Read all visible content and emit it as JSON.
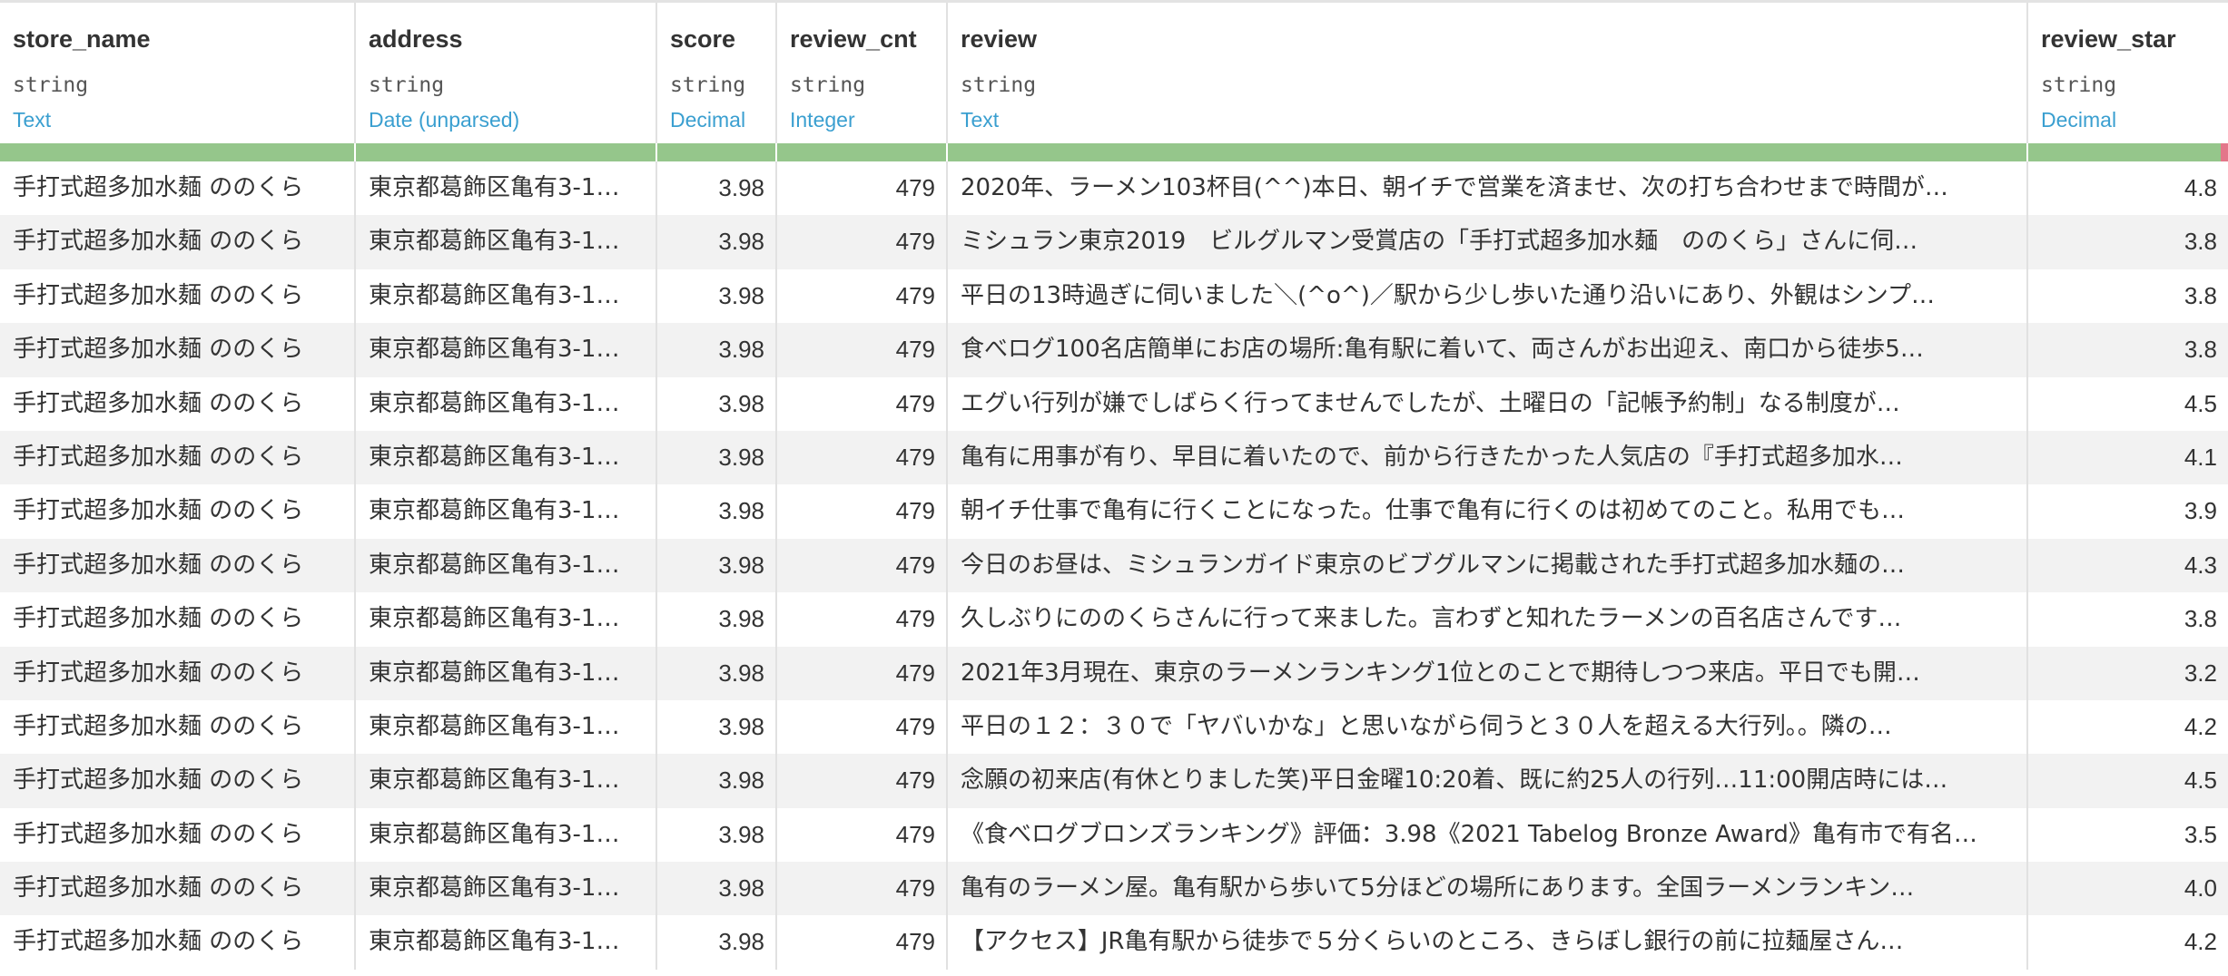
{
  "columns": [
    {
      "name": "store_name",
      "type": "string",
      "meaning": "Text"
    },
    {
      "name": "address",
      "type": "string",
      "meaning": "Date (unparsed)"
    },
    {
      "name": "score",
      "type": "string",
      "meaning": "Decimal"
    },
    {
      "name": "review_cnt",
      "type": "string",
      "meaning": "Integer"
    },
    {
      "name": "review",
      "type": "string",
      "meaning": "Text"
    },
    {
      "name": "review_star",
      "type": "string",
      "meaning": "Decimal"
    }
  ],
  "quality": {
    "valid_color": "#95c68b",
    "invalid_color": "#e3778a"
  },
  "rows": [
    {
      "store_name": "手打式超多加水麺 ののくら",
      "address": "東京都葛飾区亀有3-1…",
      "score": "3.98",
      "review_cnt": "479",
      "review": "2020年、ラーメン103杯目(^^)本日、朝イチで営業を済ませ、次の打ち合わせまで時間が…",
      "review_star": "4.8"
    },
    {
      "store_name": "手打式超多加水麺 ののくら",
      "address": "東京都葛飾区亀有3-1…",
      "score": "3.98",
      "review_cnt": "479",
      "review": "ミシュラン東京2019　ビルグルマン受賞店の「手打式超多加水麺　ののくら」さんに伺…",
      "review_star": "3.8"
    },
    {
      "store_name": "手打式超多加水麺 ののくら",
      "address": "東京都葛飾区亀有3-1…",
      "score": "3.98",
      "review_cnt": "479",
      "review": "平日の13時過ぎに伺いました＼(^o^)／駅から少し歩いた通り沿いにあり、外観はシンプ…",
      "review_star": "3.8"
    },
    {
      "store_name": "手打式超多加水麺 ののくら",
      "address": "東京都葛飾区亀有3-1…",
      "score": "3.98",
      "review_cnt": "479",
      "review": "食べログ100名店簡単にお店の場所:亀有駅に着いて、両さんがお出迎え、南口から徒歩5…",
      "review_star": "3.8"
    },
    {
      "store_name": "手打式超多加水麺 ののくら",
      "address": "東京都葛飾区亀有3-1…",
      "score": "3.98",
      "review_cnt": "479",
      "review": "エグい行列が嫌でしばらく行ってませんでしたが、土曜日の「記帳予約制」なる制度が…",
      "review_star": "4.5"
    },
    {
      "store_name": "手打式超多加水麺 ののくら",
      "address": "東京都葛飾区亀有3-1…",
      "score": "3.98",
      "review_cnt": "479",
      "review": "亀有に用事が有り、早目に着いたので、前から行きたかった人気店の『手打式超多加水…",
      "review_star": "4.1"
    },
    {
      "store_name": "手打式超多加水麺 ののくら",
      "address": "東京都葛飾区亀有3-1…",
      "score": "3.98",
      "review_cnt": "479",
      "review": "朝イチ仕事で亀有に行くことになった。仕事で亀有に行くのは初めてのこと。私用でも…",
      "review_star": "3.9"
    },
    {
      "store_name": "手打式超多加水麺 ののくら",
      "address": "東京都葛飾区亀有3-1…",
      "score": "3.98",
      "review_cnt": "479",
      "review": "今日のお昼は、ミシュランガイド東京のビブグルマンに掲載された手打式超多加水麺の…",
      "review_star": "4.3"
    },
    {
      "store_name": "手打式超多加水麺 ののくら",
      "address": "東京都葛飾区亀有3-1…",
      "score": "3.98",
      "review_cnt": "479",
      "review": "久しぶりにののくらさんに行って来ました。言わずと知れたラーメンの百名店さんです…",
      "review_star": "3.8"
    },
    {
      "store_name": "手打式超多加水麺 ののくら",
      "address": "東京都葛飾区亀有3-1…",
      "score": "3.98",
      "review_cnt": "479",
      "review": "2021年3月現在、東京のラーメンランキング1位とのことで期待しつつ来店。平日でも開…",
      "review_star": "3.2"
    },
    {
      "store_name": "手打式超多加水麺 ののくら",
      "address": "東京都葛飾区亀有3-1…",
      "score": "3.98",
      "review_cnt": "479",
      "review": "平日の１２：３０で「ヤバいかな」と思いながら伺うと３０人を超える大行列。。隣の…",
      "review_star": "4.2"
    },
    {
      "store_name": "手打式超多加水麺 ののくら",
      "address": "東京都葛飾区亀有3-1…",
      "score": "3.98",
      "review_cnt": "479",
      "review": "念願の初来店(有休とりました笑)平日金曜10:20着、既に約25人の行列…11:00開店時には…",
      "review_star": "4.5"
    },
    {
      "store_name": "手打式超多加水麺 ののくら",
      "address": "東京都葛飾区亀有3-1…",
      "score": "3.98",
      "review_cnt": "479",
      "review": "《食べログブロンズランキング》評価：3.98《2021 Tabelog Bronze Award》亀有市で有名…",
      "review_star": "3.5"
    },
    {
      "store_name": "手打式超多加水麺 ののくら",
      "address": "東京都葛飾区亀有3-1…",
      "score": "3.98",
      "review_cnt": "479",
      "review": "亀有のラーメン屋。亀有駅から歩いて5分ほどの場所にあります。全国ラーメンランキン…",
      "review_star": "4.0"
    },
    {
      "store_name": "手打式超多加水麺 ののくら",
      "address": "東京都葛飾区亀有3-1…",
      "score": "3.98",
      "review_cnt": "479",
      "review": "【アクセス】JR亀有駅から徒歩で５分くらいのところ、きらぼし銀行の前に拉麺屋さん…",
      "review_star": "4.2"
    }
  ]
}
